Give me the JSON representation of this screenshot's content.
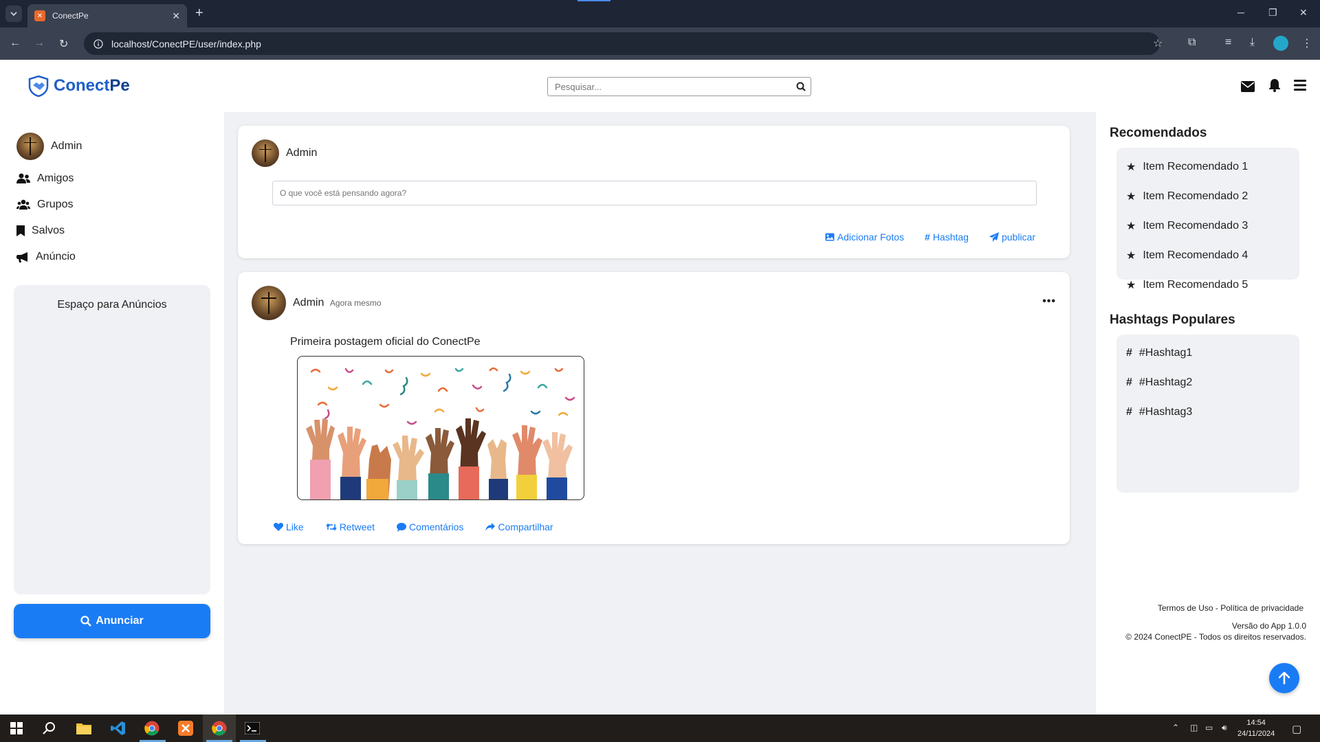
{
  "browser": {
    "tab_title": "ConectPe",
    "tab_favicon": "xampp-favicon",
    "url": "localhost/ConectPE/user/index.php"
  },
  "header": {
    "logo_part1": "Conect",
    "logo_part2": "Pe",
    "search_placeholder": "Pesquisar..."
  },
  "left_sidebar": {
    "profile_name": "Admin",
    "menu": [
      {
        "label": "Amigos",
        "icon": "user-friends-icon"
      },
      {
        "label": "Grupos",
        "icon": "users-icon"
      },
      {
        "label": "Salvos",
        "icon": "bookmark-icon"
      },
      {
        "label": "Anúncio",
        "icon": "bullhorn-icon"
      }
    ],
    "ads_title": "Espaço para Anúncios",
    "ad_button": "Anunciar"
  },
  "composer": {
    "author": "Admin",
    "placeholder": "O que você está pensando agora?",
    "actions": [
      {
        "label": "Adicionar Fotos",
        "icon": "image-icon"
      },
      {
        "label": "Hashtag",
        "icon": "hashtag-icon"
      },
      {
        "label": "publicar",
        "icon": "paper-plane-icon"
      }
    ]
  },
  "post": {
    "author": "Admin",
    "time": "Agora mesmo",
    "text": "Primeira postagem oficial do ConectPe",
    "image": "celebration-raised-hands-confetti-illustration",
    "reactions": [
      {
        "label": "Like",
        "icon": "heart-icon"
      },
      {
        "label": "Retweet",
        "icon": "retweet-icon"
      },
      {
        "label": "Comentários",
        "icon": "comment-icon"
      },
      {
        "label": "Compartilhar",
        "icon": "share-icon"
      }
    ]
  },
  "right_sidebar": {
    "recommended_title": "Recomendados",
    "recommended": [
      "Item Recomendado 1",
      "Item Recomendado 2",
      "Item Recomendado 3",
      "Item Recomendado 4",
      "Item Recomendado 5"
    ],
    "hashtags_title": "Hashtags Populares",
    "hashtags": [
      "#Hashtag1",
      "#Hashtag2",
      "#Hashtag3"
    ],
    "footer_terms": "Termos de Uso",
    "footer_sep": "-",
    "footer_privacy": "Política de privacidade",
    "footer_version": "Versão do App 1.0.0",
    "footer_copyright": "© 2024 ConectPE - Todos os direitos reservados."
  },
  "taskbar": {
    "time": "14:54",
    "date": "24/11/2024"
  },
  "colors": {
    "accent": "#1a7cf5",
    "logo_blue": "#1f5fc8",
    "feed_bg": "#eff1f4",
    "box_bg": "#f0f1f4"
  }
}
